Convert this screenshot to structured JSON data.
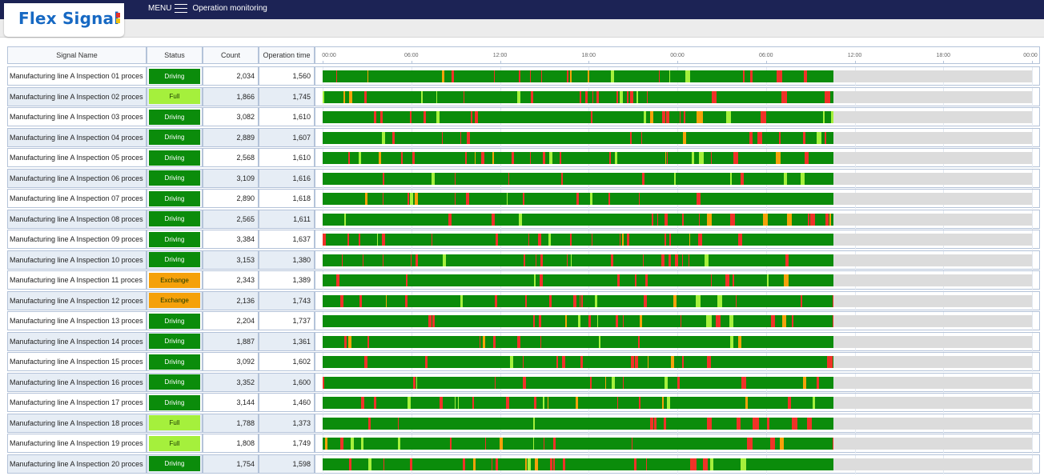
{
  "app": {
    "logo": "Flex Signal",
    "menu_label": "MENU",
    "page_title": "Operation monitoring"
  },
  "table": {
    "headers": {
      "name": "Signal Name",
      "status": "Status",
      "count": "Count",
      "operation_time": "Operation time"
    },
    "time_ticks": [
      "00:00",
      "06:00",
      "12:00",
      "18:00",
      "00:00",
      "06:00",
      "12:00",
      "18:00",
      "00:00"
    ],
    "timeline_fill_fraction": 0.72,
    "status_colors": {
      "Driving": "#0b8c0b",
      "Full": "#a5f03c",
      "Exchange": "#f5a10a"
    },
    "segment_colors": {
      "green": "#0b8c0b",
      "red": "#f03228",
      "orange": "#f5a10a",
      "lime": "#a5f03c",
      "gray": "#dcdcdc"
    },
    "rows": [
      {
        "name": "Manufacturing line A Inspection 01 proces",
        "status": "Driving",
        "count": "2,034",
        "operation_time": "1,560"
      },
      {
        "name": "Manufacturing line A Inspection 02 proces",
        "status": "Full",
        "count": "1,866",
        "operation_time": "1,745"
      },
      {
        "name": "Manufacturing line A Inspection 03 proces",
        "status": "Driving",
        "count": "3,082",
        "operation_time": "1,610"
      },
      {
        "name": "Manufacturing line A Inspection 04 proces",
        "status": "Driving",
        "count": "2,889",
        "operation_time": "1,607"
      },
      {
        "name": "Manufacturing line A Inspection 05 proces",
        "status": "Driving",
        "count": "2,568",
        "operation_time": "1,610"
      },
      {
        "name": "Manufacturing line A Inspection 06 proces",
        "status": "Driving",
        "count": "3,109",
        "operation_time": "1,616"
      },
      {
        "name": "Manufacturing line A Inspection 07 proces",
        "status": "Driving",
        "count": "2,890",
        "operation_time": "1,618"
      },
      {
        "name": "Manufacturing line A Inspection 08 proces",
        "status": "Driving",
        "count": "2,565",
        "operation_time": "1,611"
      },
      {
        "name": "Manufacturing line A Inspection 09 proces",
        "status": "Driving",
        "count": "3,384",
        "operation_time": "1,637"
      },
      {
        "name": "Manufacturing line A Inspection 10 proces",
        "status": "Driving",
        "count": "3,153",
        "operation_time": "1,380"
      },
      {
        "name": "Manufacturing line A Inspection 11 proces",
        "status": "Exchange",
        "count": "2,343",
        "operation_time": "1,389"
      },
      {
        "name": "Manufacturing line A Inspection 12 proces",
        "status": "Exchange",
        "count": "2,136",
        "operation_time": "1,743"
      },
      {
        "name": "Manufacturing line A Inspection 13 proces",
        "status": "Driving",
        "count": "2,204",
        "operation_time": "1,737"
      },
      {
        "name": "Manufacturing line A Inspection 14 proces",
        "status": "Driving",
        "count": "1,887",
        "operation_time": "1,361"
      },
      {
        "name": "Manufacturing line A Inspection 15 proces",
        "status": "Driving",
        "count": "3,092",
        "operation_time": "1,602"
      },
      {
        "name": "Manufacturing line A Inspection 16 proces",
        "status": "Driving",
        "count": "3,352",
        "operation_time": "1,600"
      },
      {
        "name": "Manufacturing line A Inspection 17 proces",
        "status": "Driving",
        "count": "3,144",
        "operation_time": "1,460"
      },
      {
        "name": "Manufacturing line A Inspection 18 proces",
        "status": "Full",
        "count": "1,788",
        "operation_time": "1,373"
      },
      {
        "name": "Manufacturing line A Inspection 19 proces",
        "status": "Full",
        "count": "1,808",
        "operation_time": "1,749"
      },
      {
        "name": "Manufacturing line A Inspection 20 proces",
        "status": "Driving",
        "count": "1,754",
        "operation_time": "1,598"
      }
    ]
  }
}
